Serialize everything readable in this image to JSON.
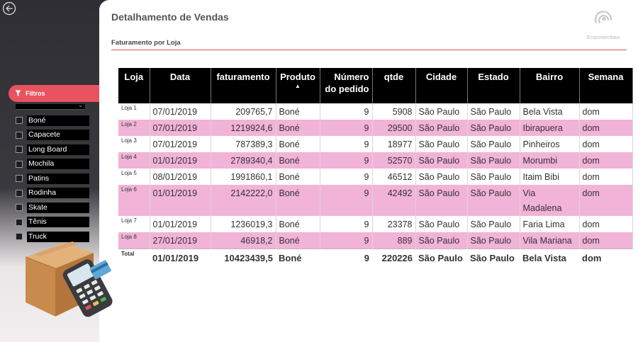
{
  "sidebar": {
    "filter_label": "Filtros",
    "items": [
      "Boné",
      "Capacete",
      "Long Board",
      "Mochila",
      "Patins",
      "Rodinha",
      "Skate",
      "Tênis",
      "Truck"
    ]
  },
  "header": {
    "title": "Detalhamento de Vendas",
    "logo_text": "Empowerdata"
  },
  "section": {
    "title": "Faturamento por Loja"
  },
  "table": {
    "columns": [
      "Loja",
      "Data",
      "faturamento",
      "Produto",
      "Número do pedido",
      "qtde",
      "Cidade",
      "Estado",
      "Bairro",
      "Semana"
    ],
    "rows": [
      [
        "Loja 1",
        "07/01/2019",
        "209765,7",
        "Boné",
        "9",
        "5908",
        "São Paulo",
        "São Paulo",
        "Bela Vista",
        "dom"
      ],
      [
        "Loja 2",
        "07/01/2019",
        "1219924,6",
        "Boné",
        "9",
        "29500",
        "São Paulo",
        "São Paulo",
        "Ibirapuera",
        "dom"
      ],
      [
        "Loja 3",
        "07/01/2019",
        "787389,3",
        "Boné",
        "9",
        "18977",
        "São Paulo",
        "São Paulo",
        "Pinheiros",
        "dom"
      ],
      [
        "Loja 4",
        "01/01/2019",
        "2789340,4",
        "Boné",
        "9",
        "52570",
        "São Paulo",
        "São Paulo",
        "Morumbi",
        "dom"
      ],
      [
        "Loja 5",
        "08/01/2019",
        "1991860,1",
        "Boné",
        "9",
        "46512",
        "São Paulo",
        "São Paulo",
        "Itaim Bibi",
        "dom"
      ],
      [
        "Loja 6",
        "01/01/2019",
        "2142222,0",
        "Boné",
        "9",
        "42492",
        "São Paulo",
        "São Paulo",
        "Via Madalena",
        "dom"
      ],
      [
        "Loja 7",
        "01/01/2019",
        "1236019,3",
        "Boné",
        "9",
        "23378",
        "São Paulo",
        "São Paulo",
        "Faria Lima",
        "dom"
      ],
      [
        "Loja 8",
        "27/01/2019",
        "46918,2",
        "Boné",
        "9",
        "889",
        "São Paulo",
        "São Paulo",
        "Vila Mariana",
        "dom"
      ]
    ],
    "total": [
      "Total",
      "01/01/2019",
      "10423439,5",
      "Boné",
      "9",
      "220226",
      "São Paulo",
      "São Paulo",
      "Bela Vista",
      "dom"
    ]
  },
  "colors": {
    "accent": "#e8535f",
    "row_highlight": "#f2b3d8",
    "header_bg": "#000000"
  },
  "icons": [
    "back-arrow-icon",
    "filter-icon",
    "chevron-down-icon",
    "empowerdata-logo-icon",
    "box-card-machine-illustration"
  ]
}
